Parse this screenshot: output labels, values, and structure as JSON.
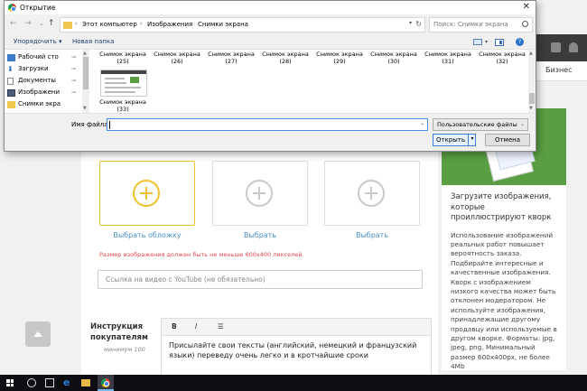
{
  "dialog": {
    "title": "Открытие",
    "close": "✕",
    "nav": {
      "back": "←",
      "forward": "→",
      "dropdown": "⌄",
      "up": "↑"
    },
    "breadcrumbs": [
      "Этот компьютер",
      "Изображения",
      "Снимки экрана"
    ],
    "crumb_sep": "›",
    "search_placeholder": "Поиск: Снимки экрана",
    "toolbar": {
      "organize": "Упорядочить ▾",
      "new_folder": "Новая папка"
    },
    "nav_pane": [
      {
        "label": "Рабочий сто",
        "icon": "desktop-icon",
        "pin": "📌"
      },
      {
        "label": "Загрузки",
        "icon": "downloads-icon",
        "pin": "📌"
      },
      {
        "label": "Документы",
        "icon": "documents-icon",
        "pin": "📌"
      },
      {
        "label": "Изображени",
        "icon": "pictures-icon",
        "pin": "📌"
      },
      {
        "label": "Снимки экра",
        "icon": "folder-icon",
        "pin": ""
      }
    ],
    "files_row1": [
      "Снимок экрана (25)",
      "Снимок экрана (26)",
      "Снимок экрана (27)",
      "Снимок экрана (28)",
      "Снимок экрана (29)",
      "Снимок экрана (30)",
      "Снимок экрана (31)",
      "Снимок экрана (32)"
    ],
    "file_33": "Снимок экрана (33)",
    "filename_label": "Имя файла:",
    "filename_value": "",
    "filter": "Пользовательские файлы",
    "open_button": "Открыть",
    "cancel_button": "Отмена"
  },
  "site": {
    "tab": "Бизнес",
    "upload_slots": [
      "Выбрать обложку",
      "Выбрать",
      "Выбрать"
    ],
    "size_warning": "Размер изображения должен быть не меньше 600х400 пикселей.",
    "youtube_placeholder": "Ссылка на видео с YouTube (не обязательно)",
    "instructions_title": "Инструкция покупателям",
    "instructions_min": "минимум 100",
    "editor_tools": [
      "B",
      "I",
      "☰"
    ],
    "editor_text": "Присылайте свои тексты (английский, немецкий и французский языки) переведу очень легко и в кротчайшие сроки",
    "side_heading": "Загрузите изображения, которые проиллюстрируют кворк",
    "side_body": "Использование изображений реальных работ повышает вероятность заказа. Подбирайте интересные и качественные изображения. Кворк с изображением низкого качества может быть отклонен модератором. Не используйте изображения, принадлежащие другому продавцу или используемые в другом кворке. Форматы: jpg, jpeg, png. Минимальный размер 600х400px, не более 4Mb"
  },
  "colors": {
    "accent": "#f0c12d",
    "green": "#5a9e44",
    "link": "#4a90c7",
    "warning": "#e0474c"
  }
}
